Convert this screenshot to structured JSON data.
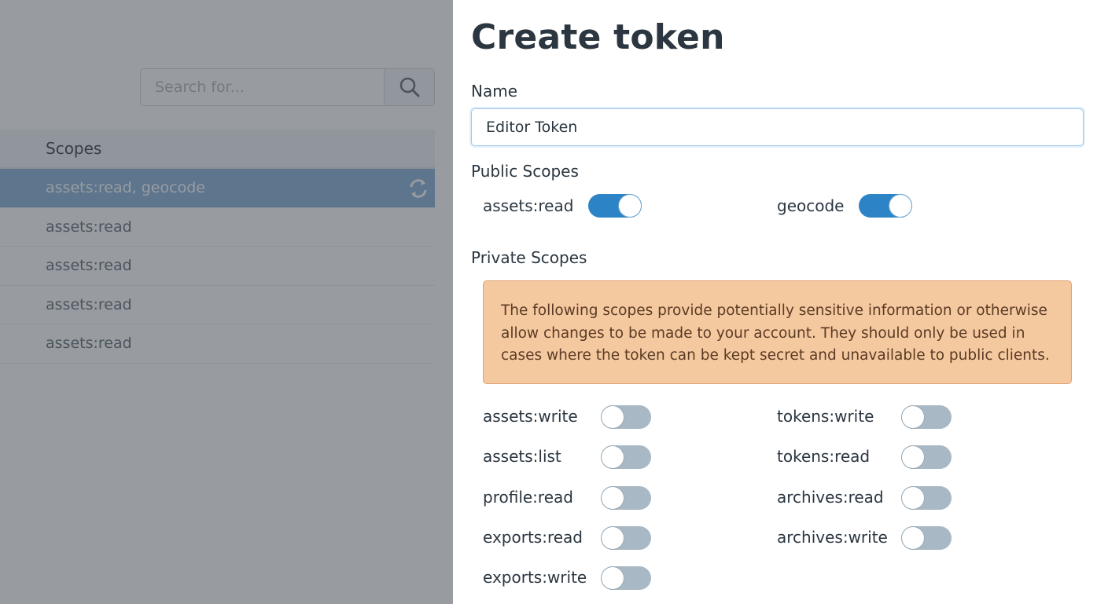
{
  "background": {
    "search": {
      "placeholder": "Search for..."
    },
    "table": {
      "header": "Scopes",
      "rows": [
        {
          "scopes": "assets:read, geocode",
          "selected": true
        },
        {
          "scopes": "assets:read",
          "selected": false
        },
        {
          "scopes": "assets:read",
          "selected": false
        },
        {
          "scopes": "assets:read",
          "selected": false
        },
        {
          "scopes": "assets:read",
          "selected": false
        }
      ]
    }
  },
  "modal": {
    "title": "Create token",
    "name_label": "Name",
    "name_value": "Editor Token",
    "public_scopes_label": "Public Scopes",
    "public_scopes": [
      {
        "name": "assets:read",
        "enabled": true
      },
      {
        "name": "geocode",
        "enabled": true
      }
    ],
    "private_scopes_label": "Private Scopes",
    "warning": "The following scopes provide potentially sensitive information or otherwise allow changes to be made to your account. They should only be used in cases where the token can be kept secret and unavailable to public clients.",
    "private_scopes": [
      {
        "name": "assets:write",
        "enabled": false
      },
      {
        "name": "tokens:write",
        "enabled": false
      },
      {
        "name": "assets:list",
        "enabled": false
      },
      {
        "name": "tokens:read",
        "enabled": false
      },
      {
        "name": "profile:read",
        "enabled": false
      },
      {
        "name": "archives:read",
        "enabled": false
      },
      {
        "name": "exports:read",
        "enabled": false
      },
      {
        "name": "archives:write",
        "enabled": false
      },
      {
        "name": "exports:write",
        "enabled": false
      }
    ]
  },
  "colors": {
    "toggle_on": "#2c84c6",
    "toggle_off": "#a8b8c4",
    "warning_bg": "#f5c9a0",
    "selected_row": "#8fb4d9"
  }
}
